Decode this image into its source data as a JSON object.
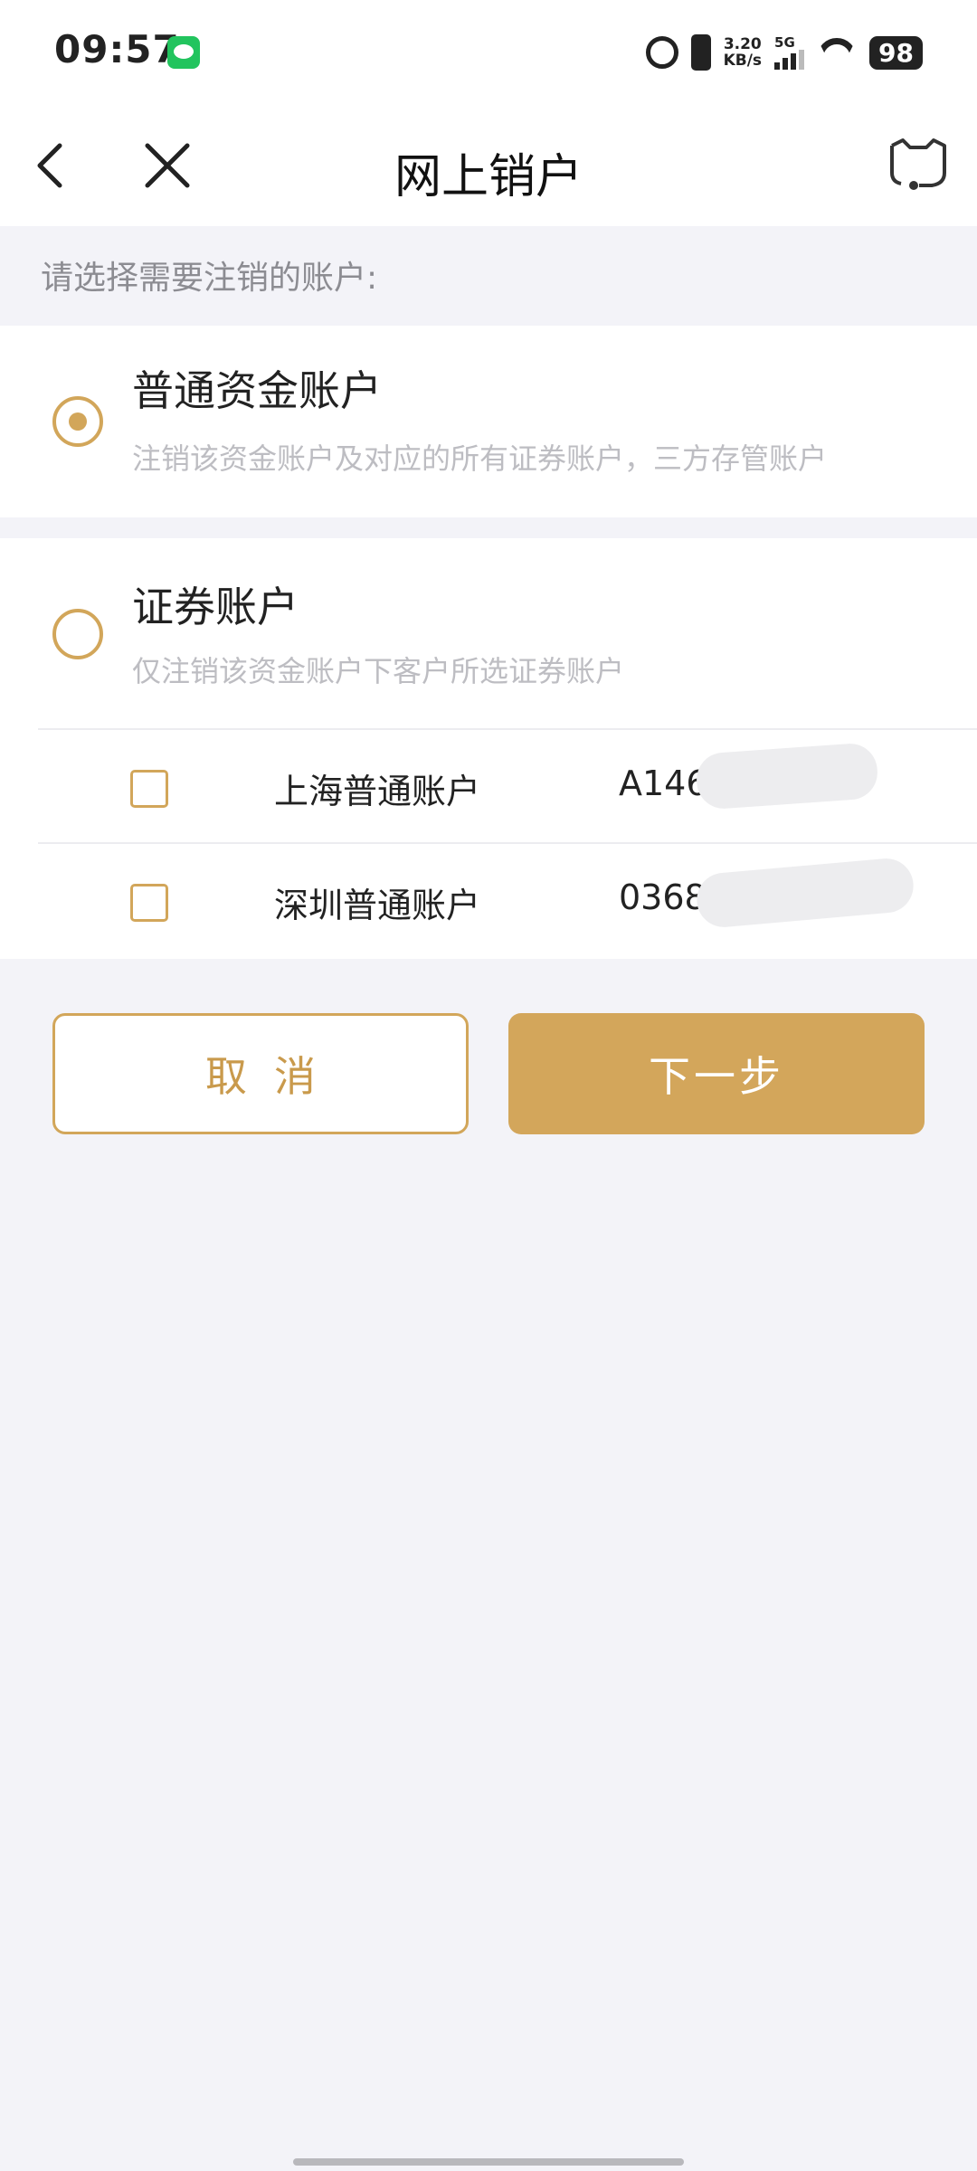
{
  "status_bar": {
    "time": "09:57",
    "net_speed_value": "3.20",
    "net_speed_unit": "KB/s",
    "network": "5G",
    "battery": "98"
  },
  "nav": {
    "title": "网上销户"
  },
  "prompt": "请选择需要注销的账户:",
  "options": {
    "fund": {
      "title": "普通资金账户",
      "desc": "注销该资金账户及对应的所有证券账户，三方存管账户",
      "selected": true
    },
    "securities": {
      "title": "证券账户",
      "desc": "仅注销该资金账户下客户所选证券账户",
      "selected": false,
      "accounts": [
        {
          "name": "上海普通账户",
          "number": "A146",
          "checked": false
        },
        {
          "name": "深圳普通账户",
          "number": "0368",
          "checked": false
        }
      ]
    }
  },
  "buttons": {
    "cancel": "取消",
    "next": "下一步"
  },
  "colors": {
    "accent": "#d3a65b",
    "background": "#f3f3f8"
  }
}
